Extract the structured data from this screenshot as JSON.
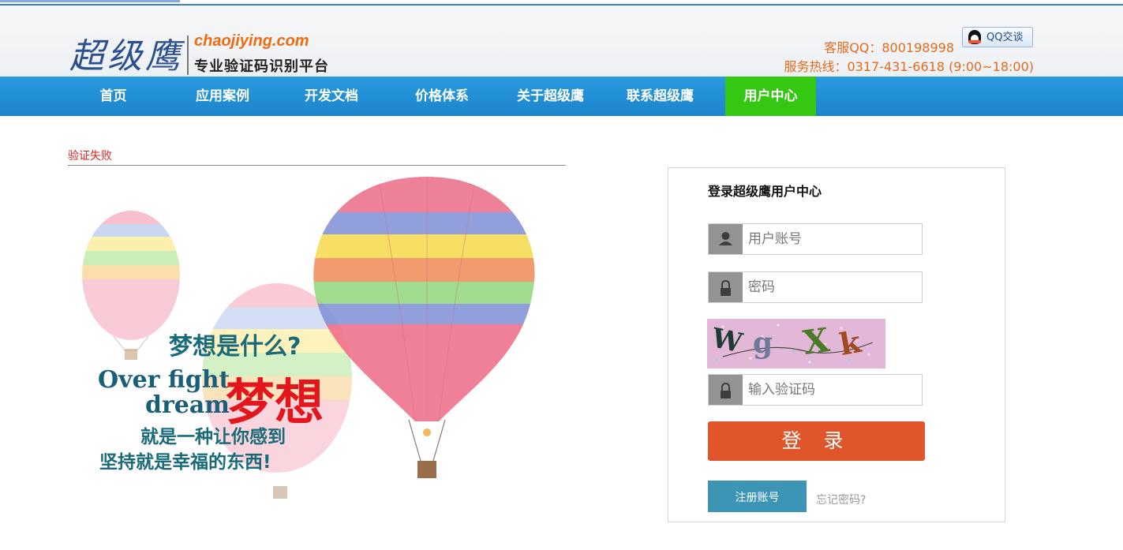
{
  "header": {
    "logo_cn": "超级鹰",
    "logo_en": "chaojiying.com",
    "logo_sub": "专业验证码识别平台",
    "qq_label": "客服QQ：800198998",
    "qq_button": "QQ交谈",
    "hotline": "服务热线：0317-431-6618 (9:00~18:00)"
  },
  "nav": {
    "items": [
      "首页",
      "应用案例",
      "开发文档",
      "价格体系",
      "关于超级鹰",
      "联系超级鹰",
      "用户中心"
    ],
    "active": "用户中心"
  },
  "error_text": "验证失败",
  "hero": {
    "line1": "梦想是什么?",
    "line2": "Over fight",
    "line3": "dream",
    "line4": "梦想",
    "line5": "就是一种让你感到",
    "line6": "坚持就是幸福的东西!"
  },
  "login": {
    "title": "登录超级鹰用户中心",
    "username_placeholder": "用户账号",
    "password_placeholder": "密码",
    "captcha_text": "WgXk",
    "captcha_placeholder": "输入验证码",
    "submit_label": "登 录",
    "register_label": "注册账号",
    "forgot_label": "忘记密码?"
  },
  "colors": {
    "nav_bg": "#1f8fd6",
    "nav_active": "#35c812",
    "accent_orange": "#e26b1f",
    "login_button": "#e0552a",
    "register_button": "#3d95b5",
    "error_red": "#dd2222"
  }
}
